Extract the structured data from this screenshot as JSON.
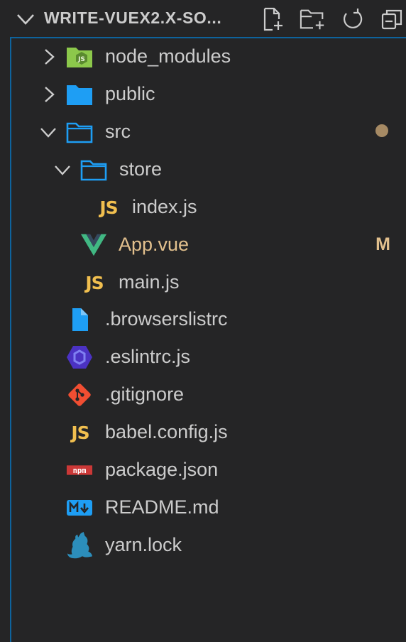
{
  "header": {
    "title": "WRITE-VUEX2.X-SO...",
    "new_file_icon": "new-file-icon",
    "new_folder_icon": "new-folder-icon",
    "refresh_icon": "refresh-icon",
    "collapse_icon": "collapse-all-icon"
  },
  "tree": {
    "node_modules": {
      "label": "node_modules",
      "icon": "nodejs-folder-icon"
    },
    "public": {
      "label": "public",
      "icon": "folder-icon"
    },
    "src": {
      "label": "src",
      "icon": "folder-open-icon"
    },
    "store": {
      "label": "store",
      "icon": "folder-open-icon"
    },
    "index_js": {
      "label": "index.js",
      "icon": "javascript-icon",
      "icon_text": "JS"
    },
    "app_vue": {
      "label": "App.vue",
      "icon": "vue-icon",
      "status": "M"
    },
    "main_js": {
      "label": "main.js",
      "icon": "javascript-icon",
      "icon_text": "JS"
    },
    "browserslistrc": {
      "label": ".browserslistrc",
      "icon": "file-icon"
    },
    "eslintrc": {
      "label": ".eslintrc.js",
      "icon": "eslint-icon"
    },
    "gitignore": {
      "label": ".gitignore",
      "icon": "git-icon"
    },
    "babel": {
      "label": "babel.config.js",
      "icon": "javascript-icon",
      "icon_text": "JS"
    },
    "package": {
      "label": "package.json",
      "icon": "npm-icon",
      "icon_text": "npm"
    },
    "readme": {
      "label": "README.md",
      "icon": "markdown-icon"
    },
    "yarn": {
      "label": "yarn.lock",
      "icon": "yarn-icon"
    }
  },
  "colors": {
    "background": "#252526",
    "text": "#cccccc",
    "modified": "#e2c08d",
    "focus_border": "#0e639c",
    "folder": "#1e9ef4",
    "js": "#f1bf4f"
  }
}
